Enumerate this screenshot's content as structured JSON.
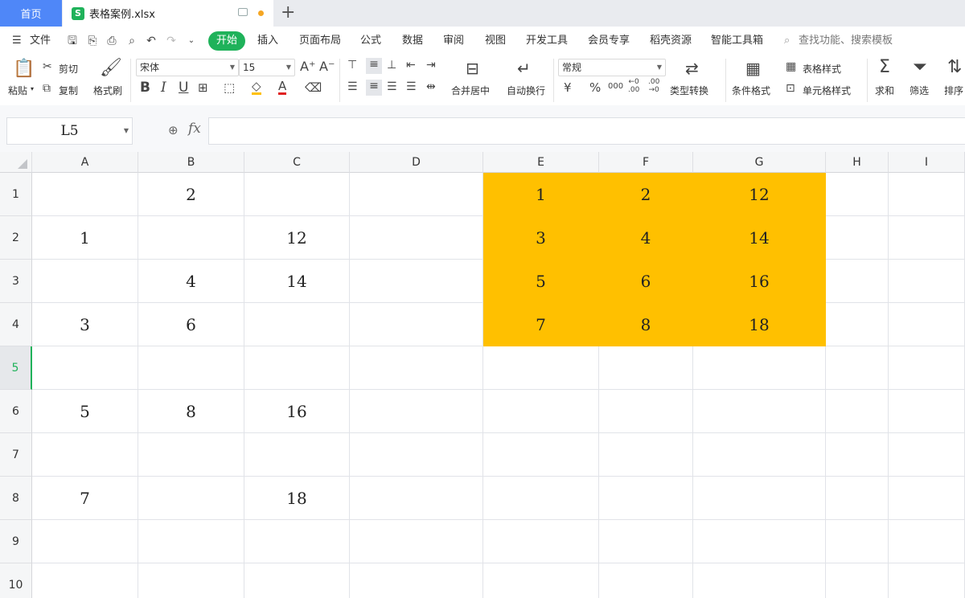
{
  "tabs": {
    "home": "首页",
    "file": "表格案例.xlsx",
    "file_icon": "S",
    "add": "+"
  },
  "menu": {
    "file": "文件",
    "items": [
      "开始",
      "插入",
      "页面布局",
      "公式",
      "数据",
      "审阅",
      "视图",
      "开发工具",
      "会员专享",
      "稻壳资源",
      "智能工具箱"
    ],
    "search": "查找功能、搜索模板"
  },
  "ribbon": {
    "paste": "粘贴",
    "cut": "剪切",
    "copy": "复制",
    "format_painter": "格式刷",
    "font_name": "宋体",
    "font_size": "15",
    "bold": "B",
    "italic": "I",
    "underline": "U",
    "merge_center": "合并居中",
    "wrap_text": "自动换行",
    "number_format": "常规",
    "currency": "¥",
    "percent": "%",
    "thousands": "000",
    "type_convert": "类型转换",
    "conditional_format": "条件格式",
    "table_style": "表格样式",
    "cell_style": "单元格样式",
    "sum": "求和",
    "filter": "筛选",
    "sort": "排序"
  },
  "formula": {
    "name_box": "L5",
    "fx": "fx",
    "content": ""
  },
  "sheet": {
    "columns": [
      "A",
      "B",
      "C",
      "D",
      "E",
      "F",
      "G",
      "H",
      "I"
    ],
    "rows": [
      "1",
      "2",
      "3",
      "4",
      "5",
      "6",
      "7",
      "8",
      "9",
      "10"
    ],
    "active_row": "5",
    "highlight_color": "#FFC000",
    "cells": {
      "B1": "2",
      "A2": "1",
      "C2": "12",
      "B3": "4",
      "C3": "14",
      "A4": "3",
      "B4": "6",
      "A6": "5",
      "B6": "8",
      "C6": "16",
      "A8": "7",
      "C8": "18",
      "E1": "1",
      "F1": "2",
      "G1": "12",
      "E2": "3",
      "F2": "4",
      "G2": "14",
      "E3": "5",
      "F3": "6",
      "G3": "16",
      "E4": "7",
      "F4": "8",
      "G4": "18"
    },
    "highlighted_range": "E1:G4"
  }
}
